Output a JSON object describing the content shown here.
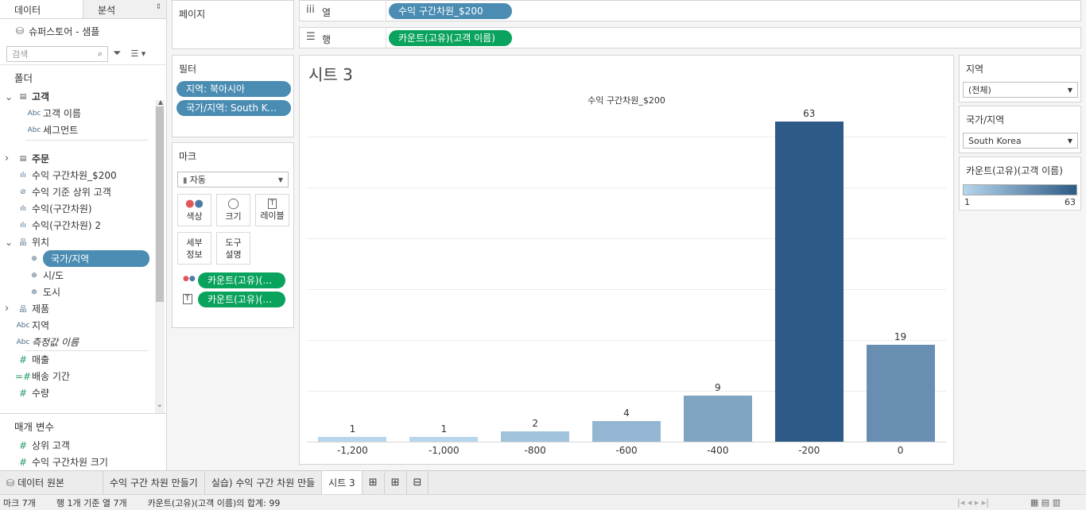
{
  "left": {
    "tabs": [
      "데이터",
      "분석"
    ],
    "datasource": "슈퍼스토어 - 샘플",
    "search_placeholder": "검색",
    "folder_title": "폴더",
    "fields": [
      {
        "name": "고객",
        "kind": "folder-open",
        "indent": 0,
        "bold": true
      },
      {
        "name": "고객 이름",
        "kind": "abc",
        "indent": 1
      },
      {
        "name": "세그먼트",
        "kind": "abc",
        "indent": 1
      },
      {
        "name": "주문",
        "kind": "folder-closed",
        "indent": 0,
        "bold": true
      },
      {
        "name": "수익 구간차원_$200",
        "kind": "bin",
        "indent": 0
      },
      {
        "name": "수익 기준 상위 고객",
        "kind": "set",
        "indent": 0
      },
      {
        "name": "수익(구간차원)",
        "kind": "bin",
        "indent": 0
      },
      {
        "name": "수익(구간차원) 2",
        "kind": "bin",
        "indent": 0
      },
      {
        "name": "위치",
        "kind": "hier-open",
        "indent": 0
      },
      {
        "name": "국가/지역",
        "kind": "geo",
        "indent": 1,
        "selected": true
      },
      {
        "name": "시/도",
        "kind": "geo",
        "indent": 1
      },
      {
        "name": "도시",
        "kind": "geo",
        "indent": 1
      },
      {
        "name": "제품",
        "kind": "hier-closed",
        "indent": 0
      },
      {
        "name": "지역",
        "kind": "abc",
        "indent": 0
      },
      {
        "name": "측정값 이름",
        "kind": "abc-italic",
        "indent": 0
      },
      {
        "name": "매출",
        "kind": "measure",
        "indent": 0
      },
      {
        "name": "배송 기간",
        "kind": "measure-calc",
        "indent": 0
      },
      {
        "name": "수량",
        "kind": "measure",
        "indent": 0
      }
    ],
    "params_title": "매개 변수",
    "params": [
      "상위 고객",
      "수익 구간차원 크기"
    ]
  },
  "pages": {
    "title": "페이지"
  },
  "filters": {
    "title": "필터",
    "items": [
      "지역: 북아시아",
      "국가/지역: South Kor.."
    ]
  },
  "marks": {
    "title": "마크",
    "type": "자동",
    "buttons": [
      {
        "label": "색상",
        "icon": "color-icon"
      },
      {
        "label": "크기",
        "icon": "size-icon"
      },
      {
        "label": "레이블",
        "icon": "label-icon"
      },
      {
        "label": "세부\n정보",
        "icon": "detail-icon"
      },
      {
        "label": "도구\n설명",
        "icon": "tooltip-icon"
      }
    ],
    "pills": [
      "카운트(고유)(고..",
      "카운트(고유)(고.."
    ]
  },
  "shelves": {
    "columns_label": "열",
    "columns_pill": "수익 구간차원_$200",
    "rows_label": "행",
    "rows_pill": "카운트(고유)(고객 이름)"
  },
  "sheet_title": "시트 3",
  "chart_data": {
    "type": "bar",
    "title": "수익 구간차원_$200",
    "categories": [
      "-1,200",
      "-1,000",
      "-800",
      "-600",
      "-400",
      "-200",
      "0"
    ],
    "values": [
      1,
      1,
      2,
      4,
      9,
      63,
      19
    ],
    "xlabel": "수익 구간차원_$200",
    "ylabel": "",
    "ylim": [
      0,
      65
    ],
    "grid": true,
    "color_scale": {
      "min": 1,
      "max": 63,
      "low_color": "#b7d6ec",
      "high_color": "#2d5a86"
    }
  },
  "right": {
    "region_title": "지역",
    "region_value": "(전체)",
    "country_title": "국가/지역",
    "country_value": "South Korea",
    "legend_title": "카운트(고유)(고객 이름)",
    "legend_min": "1",
    "legend_max": "63"
  },
  "sheet_tabs": [
    "데이터 원본",
    "수익 구간 차원 만들기",
    "실습) 수익 구간 차원 만들",
    "시트 3"
  ],
  "status": {
    "marks": "마크 7개",
    "rows": "행 1개 기준 열 7개",
    "sum": "카운트(고유)(고객 이름)의 합계: 99"
  }
}
